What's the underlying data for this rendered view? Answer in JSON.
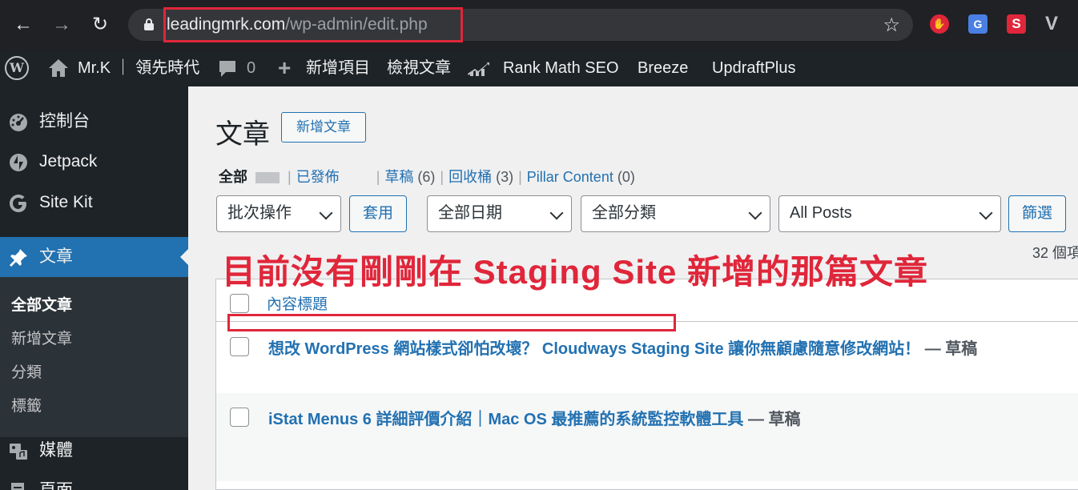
{
  "browser": {
    "url_host": "leadingmrk.com",
    "url_path": "/wp-admin/edit.php",
    "extensions": [
      "stop-extension-icon",
      "translate-extension-icon",
      "s-extension-icon",
      "v-extension-icon"
    ],
    "ext_labels": {
      "stop": "✋",
      "translate": "G",
      "s": "S",
      "v": "V"
    }
  },
  "adminbar": {
    "site_name": "Mr.K ｜ 領先時代",
    "comments_count": "0",
    "new_item": "新增項目",
    "view_posts": "檢視文章",
    "rank_math": "Rank Math SEO",
    "breeze": "Breeze",
    "updraft": "UpdraftPlus"
  },
  "sidebar": {
    "items": [
      {
        "label": "控制台",
        "icon": "gauge-icon"
      },
      {
        "label": "Jetpack",
        "icon": "jetpack-icon"
      },
      {
        "label": "Site Kit",
        "icon": "google-g-icon"
      },
      {
        "label": "文章",
        "icon": "pushpin-icon"
      },
      {
        "label": "媒體",
        "icon": "media-icon"
      },
      {
        "label": "頁面",
        "icon": "page-icon"
      }
    ],
    "submenu": [
      "全部文章",
      "新增文章",
      "分類",
      "標籤"
    ]
  },
  "main": {
    "title": "文章",
    "add_new": "新增文章",
    "filters": {
      "all": "全部",
      "published": "已發佈",
      "drafts": "草稿",
      "drafts_count": "(6)",
      "trash": "回收桶",
      "trash_count": "(3)",
      "pillar": "Pillar Content",
      "pillar_count": "(0)"
    },
    "bulk_action": "批次操作",
    "apply": "套用",
    "all_dates": "全部日期",
    "all_categories": "全部分類",
    "all_posts": "All Posts",
    "filter": "篩選",
    "items_count": "32 個項"
  },
  "annotation": "目前沒有剛剛在 Staging Site 新增的那篇文章",
  "table": {
    "column_title": "內容標題",
    "rows": [
      {
        "title": "想改 WordPress 網站樣式卻怕改壞？ Cloudways Staging Site 讓你無顧慮隨意修改網站！",
        "state": " — 草稿"
      },
      {
        "title": "iStat Menus 6 詳細評價介紹｜Mac OS 最推薦的系統監控軟體工具",
        "state": " — 草稿"
      }
    ]
  },
  "colors": {
    "accent": "#2271b1",
    "admin_bg": "#1d2327",
    "annotation_red": "#e0263a"
  }
}
